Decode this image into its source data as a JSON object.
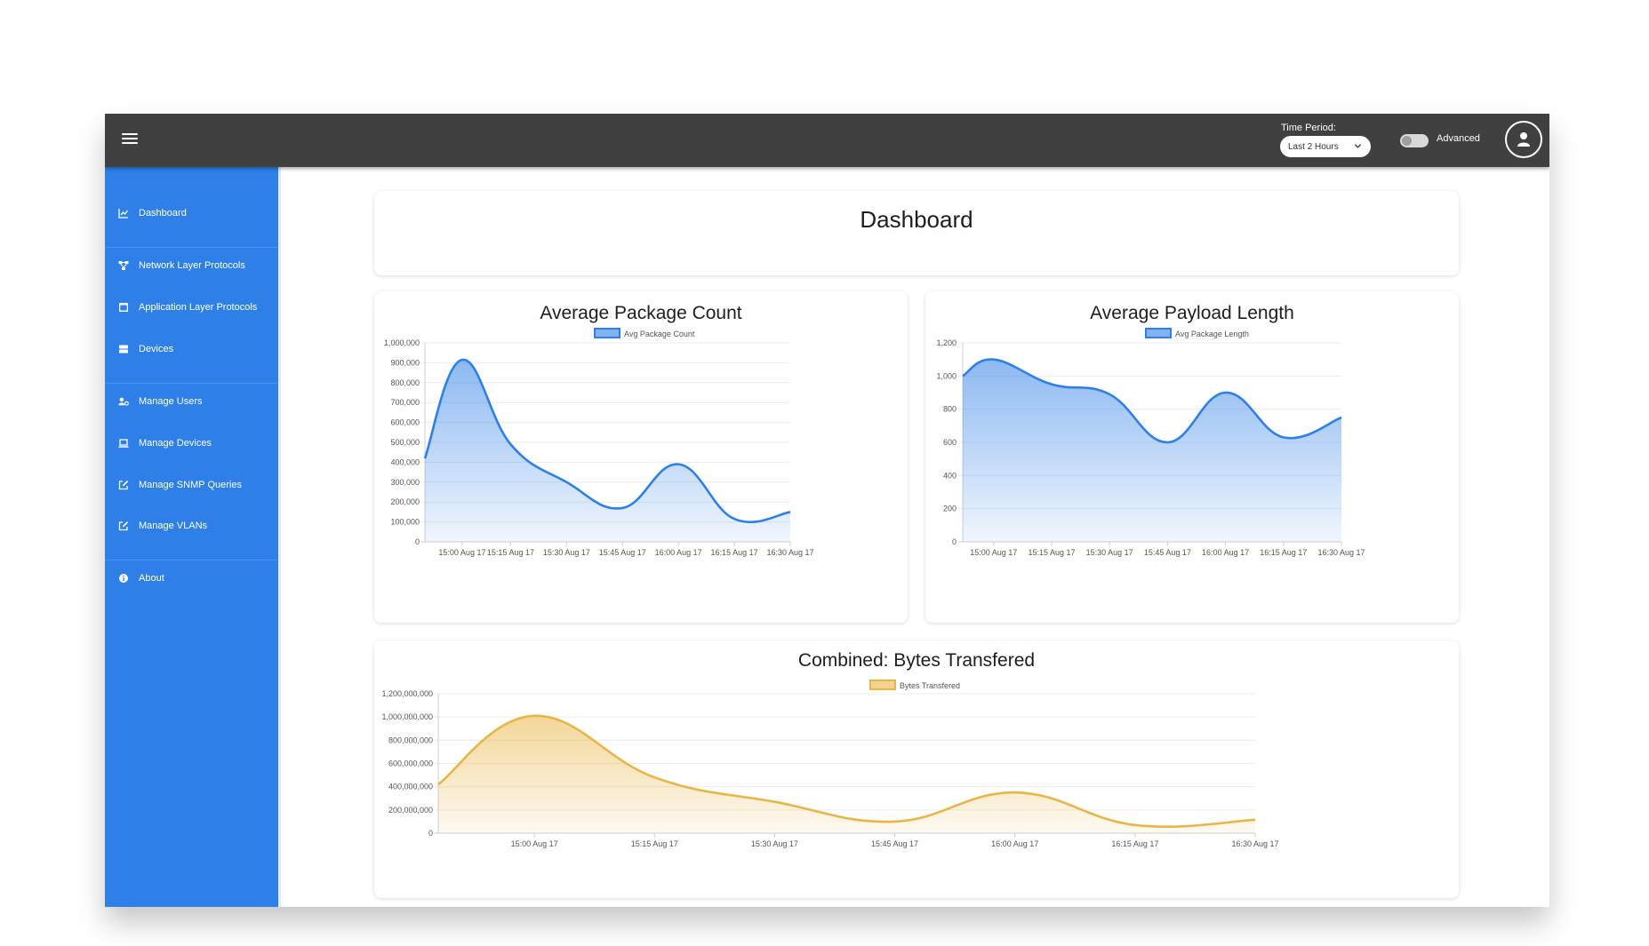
{
  "header": {
    "time_period_label": "Time Period:",
    "time_period_value": "Last 2 Hours",
    "advanced_label": "Advanced"
  },
  "sidebar": {
    "items": [
      {
        "label": "Dashboard",
        "icon": "line-chart-icon"
      },
      {
        "label": "Network Layer Protocols",
        "icon": "network-icon"
      },
      {
        "label": "Application Layer Protocols",
        "icon": "window-icon"
      },
      {
        "label": "Devices",
        "icon": "server-icon"
      },
      {
        "label": "Manage Users",
        "icon": "user-cog-icon"
      },
      {
        "label": "Manage Devices",
        "icon": "laptop-icon"
      },
      {
        "label": "Manage SNMP Queries",
        "icon": "edit-icon"
      },
      {
        "label": "Manage VLANs",
        "icon": "edit-icon"
      },
      {
        "label": "About",
        "icon": "info-icon"
      }
    ]
  },
  "main": {
    "title": "Dashboard"
  },
  "chart_data": [
    {
      "id": "package",
      "type": "area",
      "title": "Average Package Count",
      "x": [
        "14:52",
        "15:02",
        "15:15",
        "15:30",
        "15:45",
        "16:00",
        "16:15",
        "16:30"
      ],
      "x_tick_labels": [
        "15:00 Aug 17",
        "15:15 Aug 17",
        "15:30 Aug 17",
        "15:45 Aug 17",
        "16:00 Aug 17",
        "16:15 Aug 17",
        "16:30 Aug 17"
      ],
      "y_ticks": [
        "1,000,000",
        "900,000",
        "800,000",
        "700,000",
        "600,000",
        "500,000",
        "400,000",
        "300,000",
        "200,000",
        "100,000",
        "0"
      ],
      "ylim": [
        0,
        1000000
      ],
      "grid": true,
      "legend": "top-center",
      "color": "#2e80e8",
      "series": [
        {
          "name": "Avg Package Count",
          "values": [
            420000,
            915000,
            490000,
            300000,
            170000,
            390000,
            115000,
            150000
          ]
        }
      ]
    },
    {
      "id": "payload",
      "type": "area",
      "title": "Average Payload Length",
      "x": [
        "14:52",
        "15:00",
        "15:15",
        "15:30",
        "15:45",
        "16:00",
        "16:15",
        "16:30"
      ],
      "x_tick_labels": [
        "15:00 Aug 17",
        "15:15 Aug 17",
        "15:30 Aug 17",
        "15:45 Aug 17",
        "16:00 Aug 17",
        "16:15 Aug 17",
        "16:30 Aug 17"
      ],
      "y_ticks": [
        "1,200",
        "1,000",
        "800",
        "600",
        "400",
        "200",
        "0"
      ],
      "ylim": [
        0,
        1200
      ],
      "grid": true,
      "legend": "top-center",
      "color": "#2e80e8",
      "series": [
        {
          "name": "Avg Package Length",
          "values": [
            1000,
            1100,
            950,
            890,
            600,
            900,
            630,
            750
          ]
        }
      ]
    },
    {
      "id": "bytes",
      "type": "area",
      "title": "Combined: Bytes Transfered",
      "x": [
        "14:48",
        "15:00",
        "15:15",
        "15:30",
        "15:45",
        "16:00",
        "16:15",
        "16:30"
      ],
      "x_tick_labels": [
        "15:00 Aug 17",
        "15:15 Aug 17",
        "15:30 Aug 17",
        "15:45 Aug 17",
        "16:00 Aug 17",
        "16:15 Aug 17",
        "16:30 Aug 17"
      ],
      "y_ticks": [
        "1,200,000,000",
        "1,000,000,000",
        "800,000,000",
        "600,000,000",
        "400,000,000",
        "200,000,000",
        "0"
      ],
      "ylim": [
        0,
        1200000000
      ],
      "grid": true,
      "legend": "top-center",
      "color": "#e9b544",
      "series": [
        {
          "name": "Bytes Transfered",
          "values": [
            420000000,
            1010000000,
            480000000,
            270000000,
            100000000,
            350000000,
            70000000,
            115000000
          ]
        }
      ]
    }
  ]
}
